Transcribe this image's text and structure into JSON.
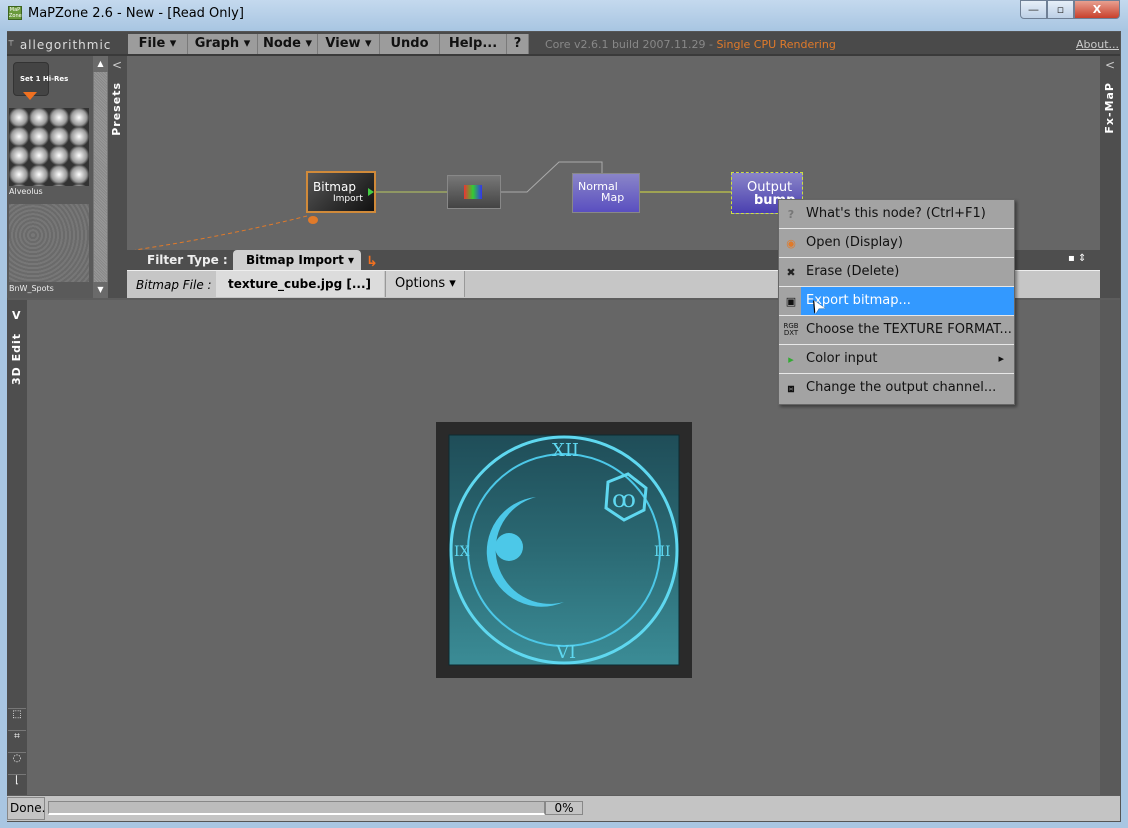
{
  "window": {
    "title": "MaPZone 2.6 - New - [Read Only]",
    "app_icon_text": "MaP Zone",
    "minimize": "—",
    "maximize": "▫",
    "close": "X"
  },
  "menubar": {
    "logo": "allegorithmic",
    "items": [
      {
        "label": "File ▾"
      },
      {
        "label": "Graph ▾"
      },
      {
        "label": "Node ▾"
      },
      {
        "label": "View ▾"
      },
      {
        "label": "Undo"
      },
      {
        "label": "Help..."
      },
      {
        "label": "?"
      }
    ],
    "core_text": "Core v2.6.1 build 2007.11.29 - ",
    "render_mode": "Single CPU Rendering",
    "about": "About..."
  },
  "presets": {
    "set_label": "Set 1 Hi-Res",
    "items": [
      {
        "label": "Alveolus"
      },
      {
        "label": "BnW_Spots"
      }
    ],
    "tab_label": "Presets",
    "collapse": "<"
  },
  "fx_tab": {
    "label": "Fx-MaP",
    "collapse": "<"
  },
  "graph": {
    "nodes": [
      {
        "title": "Bitmap",
        "sub": "Import"
      },
      {
        "title": "Normal",
        "sub": "Map"
      },
      {
        "title": "Output",
        "sub": "bump"
      }
    ]
  },
  "filter": {
    "label": "Filter Type :",
    "tab": "Bitmap Import ▾"
  },
  "file": {
    "label": "Bitmap File :",
    "value": "texture_cube.jpg [...]",
    "options": "Options ▾"
  },
  "edit": {
    "tab_label": "3D Edit",
    "collapse": "V"
  },
  "context_menu": {
    "items": [
      {
        "icon": "question-icon",
        "label": "What's this node? (Ctrl+F1)"
      },
      {
        "icon": "eye-icon",
        "label": "Open (Display)"
      },
      {
        "icon": "erase-icon",
        "label": "Erase (Delete)"
      },
      {
        "icon": "save-icon",
        "label": "Export bitmap...",
        "highlighted": true
      },
      {
        "icon": "rgb-dxt-icon",
        "label": "Choose the TEXTURE FORMAT...",
        "icon_text": "RGB DXT"
      },
      {
        "icon": "color-input-icon",
        "label": "Color input",
        "submenu": "▸"
      },
      {
        "icon": "output-channel-icon",
        "label": "Change the output channel..."
      }
    ]
  },
  "preview": {
    "numerals": [
      "XII",
      "III",
      "VI",
      "IX"
    ],
    "emblem": "ꝏ"
  },
  "status": {
    "text": "Done.",
    "progress_percent": 0,
    "progress_label": "0%"
  },
  "colors": {
    "accent_orange": "#e07a2a",
    "highlight": "#3399ff",
    "node_purple": "#5a4fc0"
  }
}
